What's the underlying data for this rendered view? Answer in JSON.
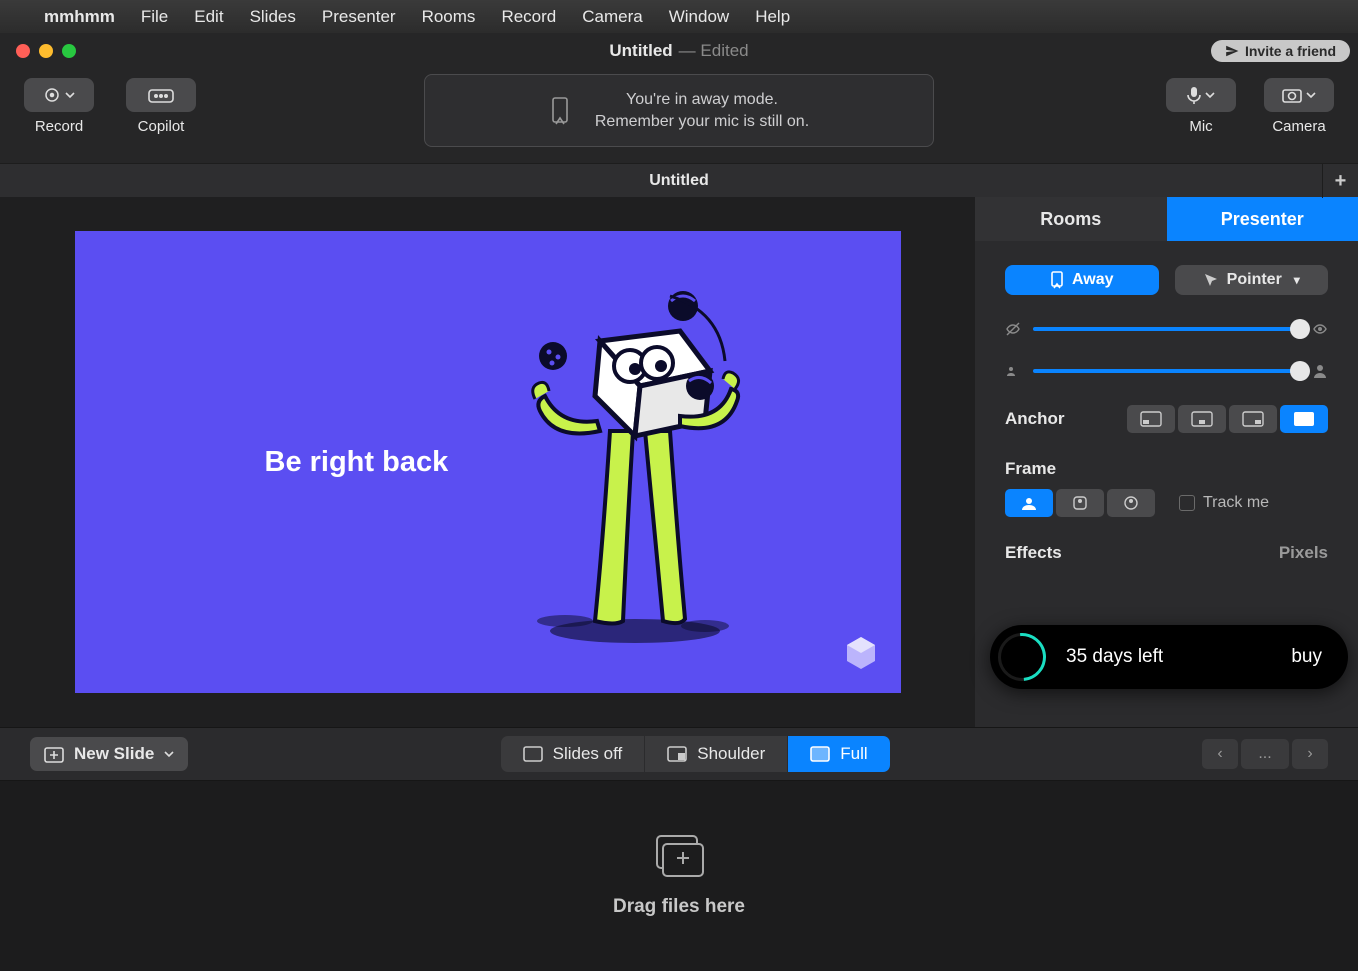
{
  "menubar": {
    "app": "mmhmm",
    "items": [
      "File",
      "Edit",
      "Slides",
      "Presenter",
      "Rooms",
      "Record",
      "Camera",
      "Window",
      "Help"
    ]
  },
  "titlebar": {
    "title": "Untitled",
    "status": "— Edited",
    "invite": "Invite a friend"
  },
  "toolbar": {
    "record": "Record",
    "copilot": "Copilot",
    "mic": "Mic",
    "camera": "Camera",
    "away_line1": "You're in away mode.",
    "away_line2": "Remember your mic is still on."
  },
  "subheader": {
    "title": "Untitled"
  },
  "slide": {
    "text": "Be right back"
  },
  "sidepanel": {
    "tabs": {
      "rooms": "Rooms",
      "presenter": "Presenter"
    },
    "away": "Away",
    "pointer": "Pointer",
    "anchor": "Anchor",
    "frame": "Frame",
    "trackme": "Track me",
    "effects": "Effects",
    "pixels": "Pixels"
  },
  "trial": {
    "days": "35 days left",
    "buy": "buy"
  },
  "strip": {
    "new_slide": "New Slide",
    "slides_off": "Slides off",
    "shoulder": "Shoulder",
    "full": "Full",
    "more": "..."
  },
  "dropzone": {
    "label": "Drag files here"
  }
}
